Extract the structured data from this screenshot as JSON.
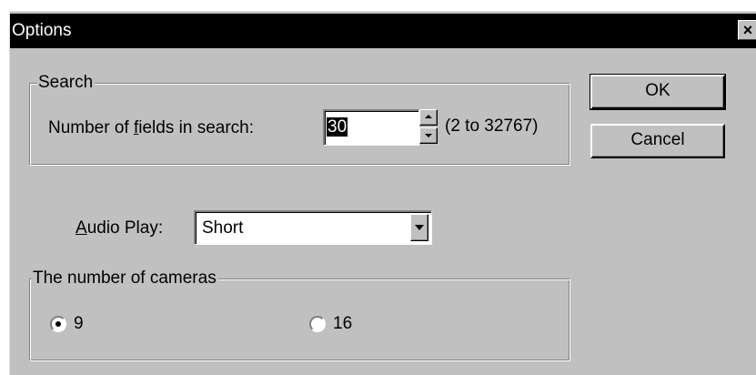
{
  "window": {
    "title": "Options",
    "close_glyph": "×"
  },
  "search_group": {
    "legend": "Search",
    "fields_label_pre": "Number of ",
    "fields_label_mnemonic": "f",
    "fields_label_post": "ields in search:",
    "fields_value": "30",
    "range_text": "(2 to 32767)"
  },
  "audio": {
    "label_mnemonic": "A",
    "label_rest": "udio Play:",
    "selected": "Short"
  },
  "cameras_group": {
    "legend": "The number of cameras",
    "options": [
      {
        "label": "9",
        "checked": true
      },
      {
        "label": "16",
        "checked": false
      }
    ]
  },
  "buttons": {
    "ok": "OK",
    "cancel": "Cancel"
  }
}
